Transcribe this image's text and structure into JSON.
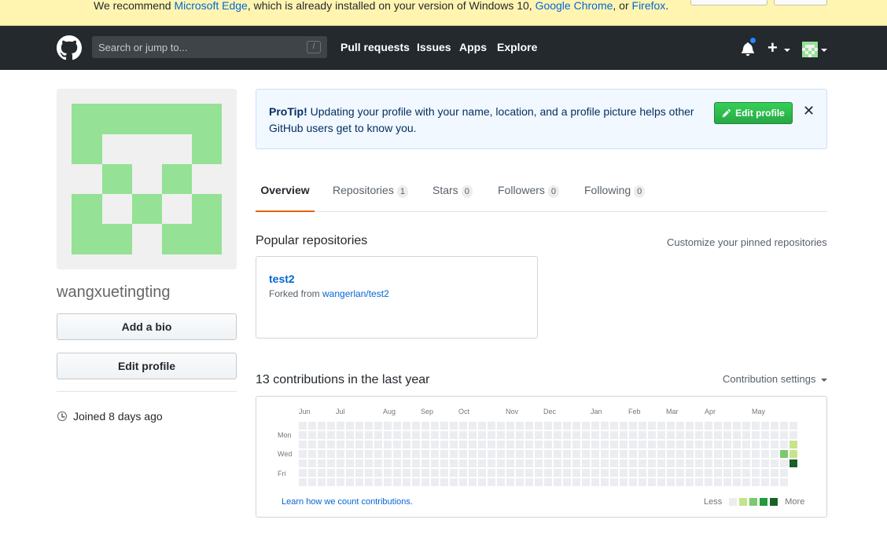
{
  "banner": {
    "text_prefix": "We recommend ",
    "edge": "Microsoft Edge",
    "text_mid": ", which is already installed on your version of Windows 10, ",
    "chrome": "Google Chrome",
    "text_or": ", or ",
    "firefox": "Firefox",
    "text_end": "."
  },
  "header": {
    "search_placeholder": "Search or jump to...",
    "search_shortcut": "/",
    "nav": [
      "Pull requests",
      "Issues",
      "Apps",
      "Explore"
    ],
    "plus": "+"
  },
  "profile": {
    "username": "wangxuetingting",
    "add_bio": "Add a bio",
    "edit_profile": "Edit profile",
    "joined": "Joined 8 days ago",
    "avatar_color": "#95e195"
  },
  "protip": {
    "title": "ProTip!",
    "text": " Updating your profile with your name, location, and a profile picture helps other GitHub users get to know you.",
    "button": "Edit profile",
    "close": "✕"
  },
  "tabs": [
    {
      "label": "Overview",
      "count": null
    },
    {
      "label": "Repositories",
      "count": "1"
    },
    {
      "label": "Stars",
      "count": "0"
    },
    {
      "label": "Followers",
      "count": "0"
    },
    {
      "label": "Following",
      "count": "0"
    }
  ],
  "popular": {
    "title": "Popular repositories",
    "customize": "Customize your pinned repositories",
    "repos": [
      {
        "name": "test2",
        "fork_prefix": "Forked from ",
        "fork_source": "wangerlan/test2"
      }
    ]
  },
  "contributions": {
    "title": "13 contributions in the last year",
    "settings": "Contribution settings",
    "months": [
      "Jun",
      "Jul",
      "Aug",
      "Sep",
      "Oct",
      "Nov",
      "Dec",
      "Jan",
      "Feb",
      "Mar",
      "Apr",
      "May"
    ],
    "weekdays": [
      "Mon",
      "Wed",
      "Fri"
    ],
    "learn": "Learn how we count contributions.",
    "less": "Less",
    "more": "More",
    "colors": [
      "#ebedf0",
      "#c6e48b",
      "#7bc96f",
      "#239a3b",
      "#196127"
    ],
    "active_cells": [
      {
        "week": 52,
        "day": 2,
        "level": 1
      },
      {
        "week": 52,
        "day": 3,
        "level": 1
      },
      {
        "week": 51,
        "day": 3,
        "level": 2
      },
      {
        "week": 52,
        "day": 4,
        "level": 4
      }
    ]
  }
}
